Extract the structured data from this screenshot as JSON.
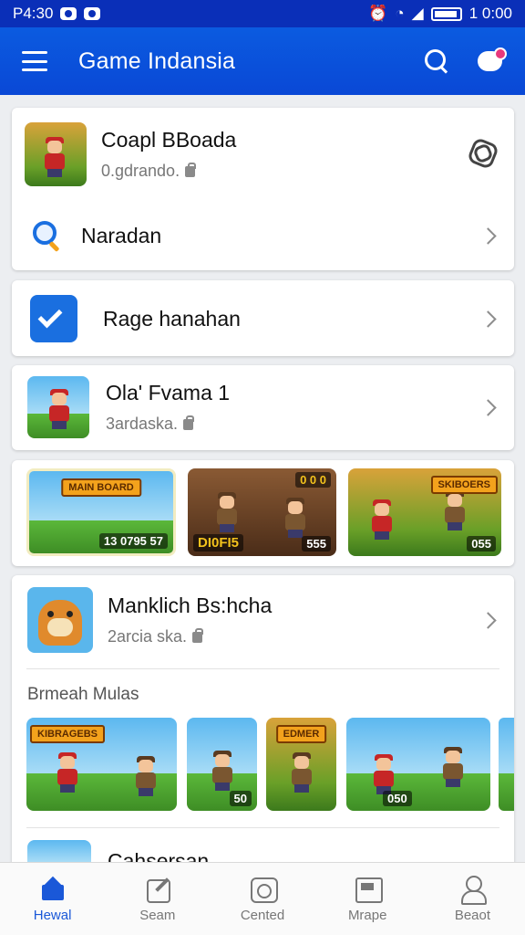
{
  "status_bar": {
    "time": "P4:30",
    "clock": "1 0:00"
  },
  "app_bar": {
    "title": "Game Indansia"
  },
  "featured_card": {
    "game_title": "Coapl BBoada",
    "game_meta": "0.gdrando.",
    "search_row_label": "Naradan"
  },
  "manage_card": {
    "label": "Rage hanahan"
  },
  "game_row_1": {
    "title": "Ola' Fvama 1",
    "meta": "3ardaska."
  },
  "screenshots_1": [
    {
      "banner": "MAIN BOARD",
      "score": "13 0795 57",
      "icon": "landscape-thumbnail"
    },
    {
      "banner": "0 0 0",
      "score": "DI0FI5",
      "extra": "555",
      "icon": "dungeon-thumbnail"
    },
    {
      "banner": "SKIBOERS",
      "score": "055",
      "icon": "jungle-thumbnail"
    }
  ],
  "game_row_2": {
    "title": "Manklich Bs:hcha",
    "meta": "2arcia ska."
  },
  "section": {
    "title": "Brmeah Mulas"
  },
  "screenshots_2": [
    {
      "banner": "KIBRAGEBS",
      "score": "",
      "icon": "jungle-battle-thumbnail"
    },
    {
      "banner": "",
      "score": "50",
      "icon": "grove-thumbnail"
    },
    {
      "banner": "EDMER",
      "score": "",
      "icon": "bear-thumbnail"
    },
    {
      "banner": "",
      "score": "050",
      "icon": "beach-thumbnail"
    },
    {
      "banner": "",
      "score": "",
      "icon": "partial-thumbnail"
    }
  ],
  "next_row": {
    "title": "Cahsersan"
  },
  "bottom_nav": [
    {
      "label": "Hewal",
      "icon": "home-icon",
      "active": true
    },
    {
      "label": "Seam",
      "icon": "edit-icon",
      "active": false
    },
    {
      "label": "Cented",
      "icon": "camera-icon",
      "active": false
    },
    {
      "label": "Mrape",
      "icon": "image-icon",
      "active": false
    },
    {
      "label": "Beaot",
      "icon": "person-icon",
      "active": false
    }
  ],
  "colors": {
    "primary": "#0a48d6",
    "accent": "#1a58d8",
    "badge": "#e8387c"
  }
}
